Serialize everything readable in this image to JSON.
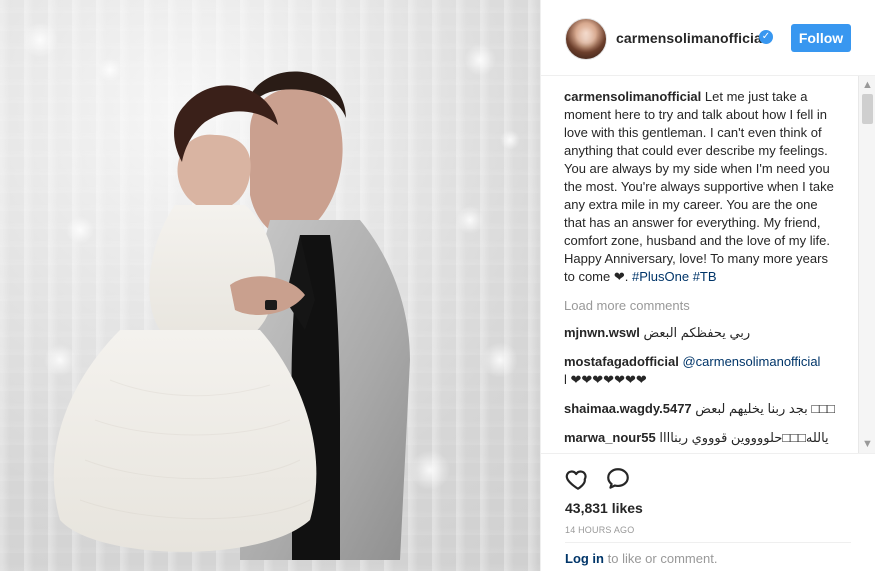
{
  "post": {
    "author": {
      "username": "carmensolimanofficial",
      "verified_badge_text": "✓"
    },
    "follow_label": "Follow",
    "caption": {
      "username": "carmensolimanofficial",
      "text": "Let me just take a moment here to try and talk about how I fell in love with this gentleman. I can't even think of anything that could ever describe my feelings. You are always by my side when I'm need you the most. You're always supportive when I take any extra mile in my career. You are the one that has an answer for everything. My friend, comfort zone, husband and the love of my life. Happy Anniversary, love! To many more years to come ❤. ",
      "hashtags": [
        "#PlusOne",
        "#TB"
      ]
    },
    "load_more_comments": "Load more comments",
    "comments": [
      {
        "username": "mjnwn.wswl",
        "text": "ربي يحفظكم البعض"
      },
      {
        "username": "mostafagadofficial",
        "mention": "@carmensolimanofficial",
        "text": "l ❤❤❤❤❤❤❤"
      },
      {
        "username": "shaimaa.wagdy.5477",
        "text": "□□□ بجد ربنا يخليهم لبعض"
      },
      {
        "username": "marwa_nour55",
        "text": "يالله□□□حلووووين قوووي ربناااا"
      }
    ],
    "likes": "43,831 likes",
    "timestamp": "14 HOURS AGO",
    "login_prompt": {
      "link": "Log in",
      "rest": " to like or comment."
    },
    "icons": {
      "like": "heart-outline-icon",
      "comment": "comment-bubble-icon",
      "scroll_up": "scroll-up-icon",
      "scroll_down": "scroll-down-icon"
    },
    "colors": {
      "accent": "#3897f0",
      "text": "#262626",
      "muted": "#999999",
      "link": "#003569",
      "border": "#efefef"
    }
  }
}
